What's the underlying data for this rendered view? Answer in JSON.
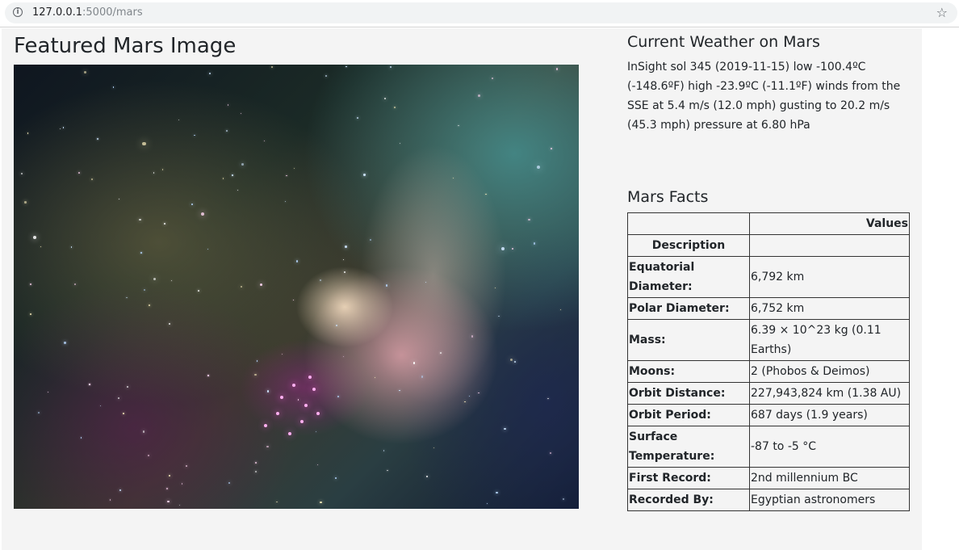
{
  "browser": {
    "url_host": "127.0.0.1",
    "url_path": ":5000/mars",
    "info_icon": "info-icon",
    "bookmark_icon": "star-icon"
  },
  "featured": {
    "title": "Featured Mars Image",
    "image": "nebula-image"
  },
  "weather": {
    "title": "Current Weather on Mars",
    "text": "InSight sol 345 (2019-11-15) low -100.4ºC (-148.6ºF) high -23.9ºC (-11.1ºF) winds from the SSE at 5.4 m/s (12.0 mph) gusting to 20.2 m/s (45.3 mph) pressure at 6.80 hPa"
  },
  "facts": {
    "title": "Mars Facts",
    "header": {
      "col1": "",
      "col2": "Values"
    },
    "index_label": "Description",
    "rows": [
      {
        "label": "Equatorial Diameter:",
        "value": "6,792 km"
      },
      {
        "label": "Polar Diameter:",
        "value": "6,752 km"
      },
      {
        "label": "Mass:",
        "value": "6.39 × 10^23 kg (0.11 Earths)"
      },
      {
        "label": "Moons:",
        "value": "2 (Phobos & Deimos)"
      },
      {
        "label": "Orbit Distance:",
        "value": "227,943,824 km (1.38 AU)"
      },
      {
        "label": "Orbit Period:",
        "value": "687 days (1.9 years)"
      },
      {
        "label": "Surface Temperature:",
        "value": "-87 to -5 °C"
      },
      {
        "label": "First Record:",
        "value": "2nd millennium BC"
      },
      {
        "label": "Recorded By:",
        "value": "Egyptian astronomers"
      }
    ]
  }
}
